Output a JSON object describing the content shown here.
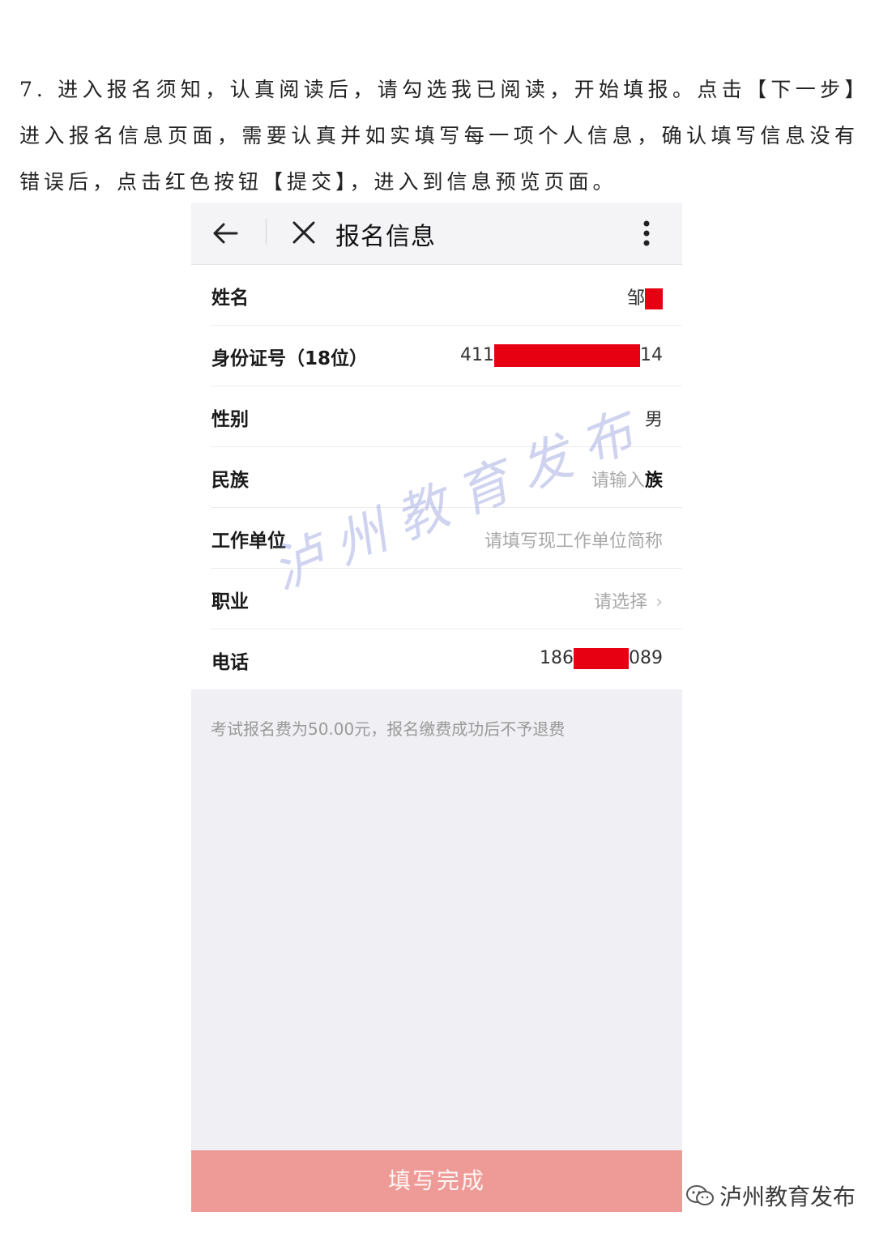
{
  "instruction": "7. 进入报名须知，认真阅读后，请勾选我已阅读，开始填报。点击【下一步】进入报名信息页面，需要认真并如实填写每一项个人信息，确认填写信息没有错误后，点击红色按钮【提交】，进入到信息预览页面。",
  "topbar": {
    "title": "报名信息",
    "back_icon": "arrow-left-icon",
    "close_icon": "close-icon",
    "more_icon": "more-vertical-icon"
  },
  "form": {
    "name": {
      "label": "姓名",
      "value_prefix": "邹"
    },
    "id_number": {
      "label": "身份证号（18位）",
      "value_prefix": "411",
      "value_suffix": "14"
    },
    "gender": {
      "label": "性别",
      "value": "男"
    },
    "ethnicity": {
      "label": "民族",
      "placeholder": "请输入",
      "value": "族"
    },
    "workplace": {
      "label": "工作单位",
      "placeholder": "请填写现工作单位简称"
    },
    "occupation": {
      "label": "职业",
      "placeholder": "请选择",
      "chevron": "›"
    },
    "phone": {
      "label": "电话",
      "value_prefix": "186",
      "value_suffix": "089"
    }
  },
  "notice": "考试报名费为50.00元，报名缴费成功后不予退费",
  "submit_label": "填写完成",
  "watermark": "泸州教育发布",
  "brand": {
    "text": "泸州教育发布",
    "icon": "wechat-icon"
  },
  "colors": {
    "redaction": "#e60012",
    "submit_bg": "#ee9a96",
    "page_bg": "#efeff4",
    "watermark": "#7882d2"
  }
}
